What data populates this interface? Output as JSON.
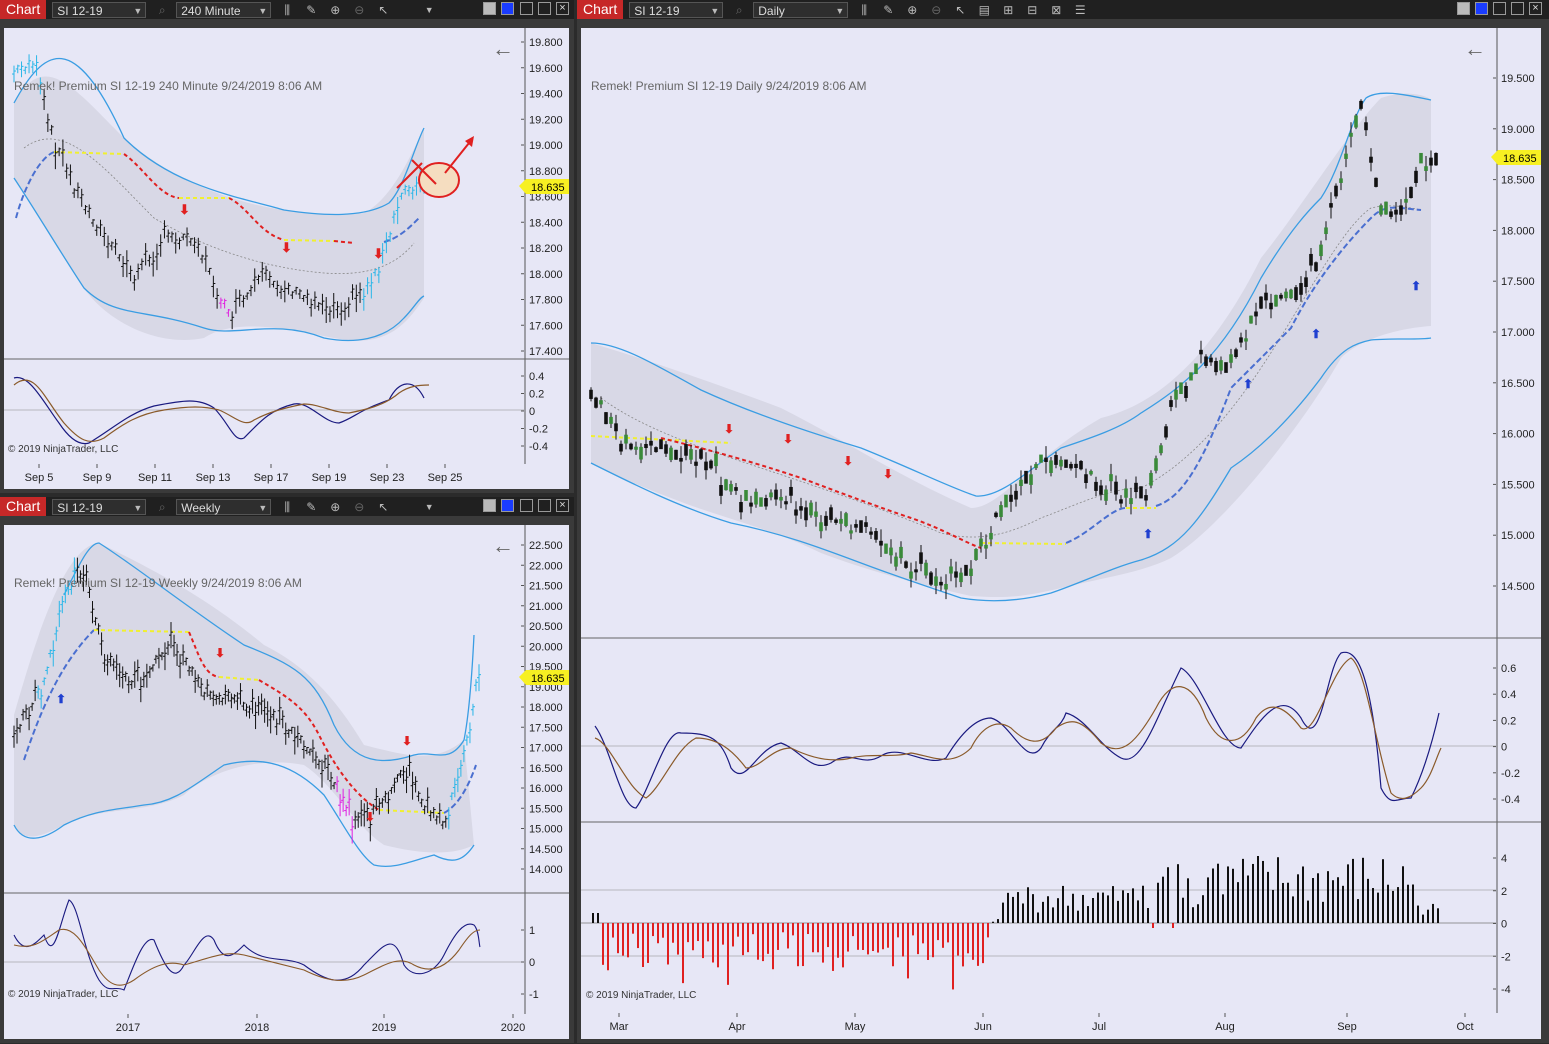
{
  "tl": {
    "tag": "Chart",
    "instrument": "SI 12-19",
    "interval": "240 Minute",
    "info": "Remek!  Premium  SI 12-19  240 Minute  9/24/2019 8:06 AM",
    "copyright": "© 2019 NinjaTrader, LLC",
    "price_tag": "18.635",
    "price_axis": [
      "19.800",
      "19.600",
      "19.400",
      "19.200",
      "19.000",
      "18.800",
      "18.600",
      "18.400",
      "18.200",
      "18.000",
      "17.800",
      "17.600",
      "17.400"
    ],
    "osc_axis": [
      "0.4",
      "0.2",
      "0",
      "-0.2",
      "-0.4"
    ],
    "time_axis": [
      "Sep 5",
      "Sep 9",
      "Sep 11",
      "Sep 13",
      "Sep 17",
      "Sep 19",
      "Sep 23",
      "Sep 25"
    ]
  },
  "bl": {
    "tag": "Chart",
    "instrument": "SI 12-19",
    "interval": "Weekly",
    "info": "Remek!  Premium  SI 12-19  Weekly  9/24/2019 8:06 AM",
    "copyright": "© 2019 NinjaTrader, LLC",
    "price_tag": "18.635",
    "price_axis": [
      "22.500",
      "22.000",
      "21.500",
      "21.000",
      "20.500",
      "20.000",
      "19.500",
      "19.000",
      "18.000",
      "17.500",
      "17.000",
      "16.500",
      "16.000",
      "15.500",
      "15.000",
      "14.500",
      "14.000"
    ],
    "osc_axis": [
      "1",
      "0",
      "-1"
    ],
    "time_axis": [
      "2017",
      "2018",
      "2019",
      "2020"
    ]
  },
  "rt": {
    "tag": "Chart",
    "instrument": "SI 12-19",
    "interval": "Daily",
    "info": "Remek!  Premium  SI 12-19  Daily  9/24/2019 8:06 AM",
    "copyright": "© 2019 NinjaTrader, LLC",
    "price_tag": "18.635",
    "price_axis": [
      "19.500",
      "19.000",
      "18.500",
      "18.000",
      "17.500",
      "17.000",
      "16.500",
      "16.000",
      "15.500",
      "15.000",
      "14.500"
    ],
    "osc_axis": [
      "0.6",
      "0.4",
      "0.2",
      "0",
      "-0.2",
      "-0.4"
    ],
    "hist_axis": [
      "4",
      "2",
      "0",
      "-2",
      "-4"
    ],
    "time_axis": [
      "Mar",
      "Apr",
      "May",
      "Jun",
      "Jul",
      "Aug",
      "Sep",
      "Oct"
    ]
  },
  "colors": {
    "upper_band": "#4aa3e0",
    "dn_trail": "#e02020",
    "up_trail": "#4a6fd0",
    "flat": "#f0f030",
    "panel_bg": "#e7e7f6",
    "band_fill": "#dadae8"
  },
  "icons": [
    "search-icon",
    "bar-style-icon",
    "draw-icon",
    "zoom-in-icon",
    "zoom-out-icon",
    "pointer-icon",
    "back-arrow-icon"
  ]
}
